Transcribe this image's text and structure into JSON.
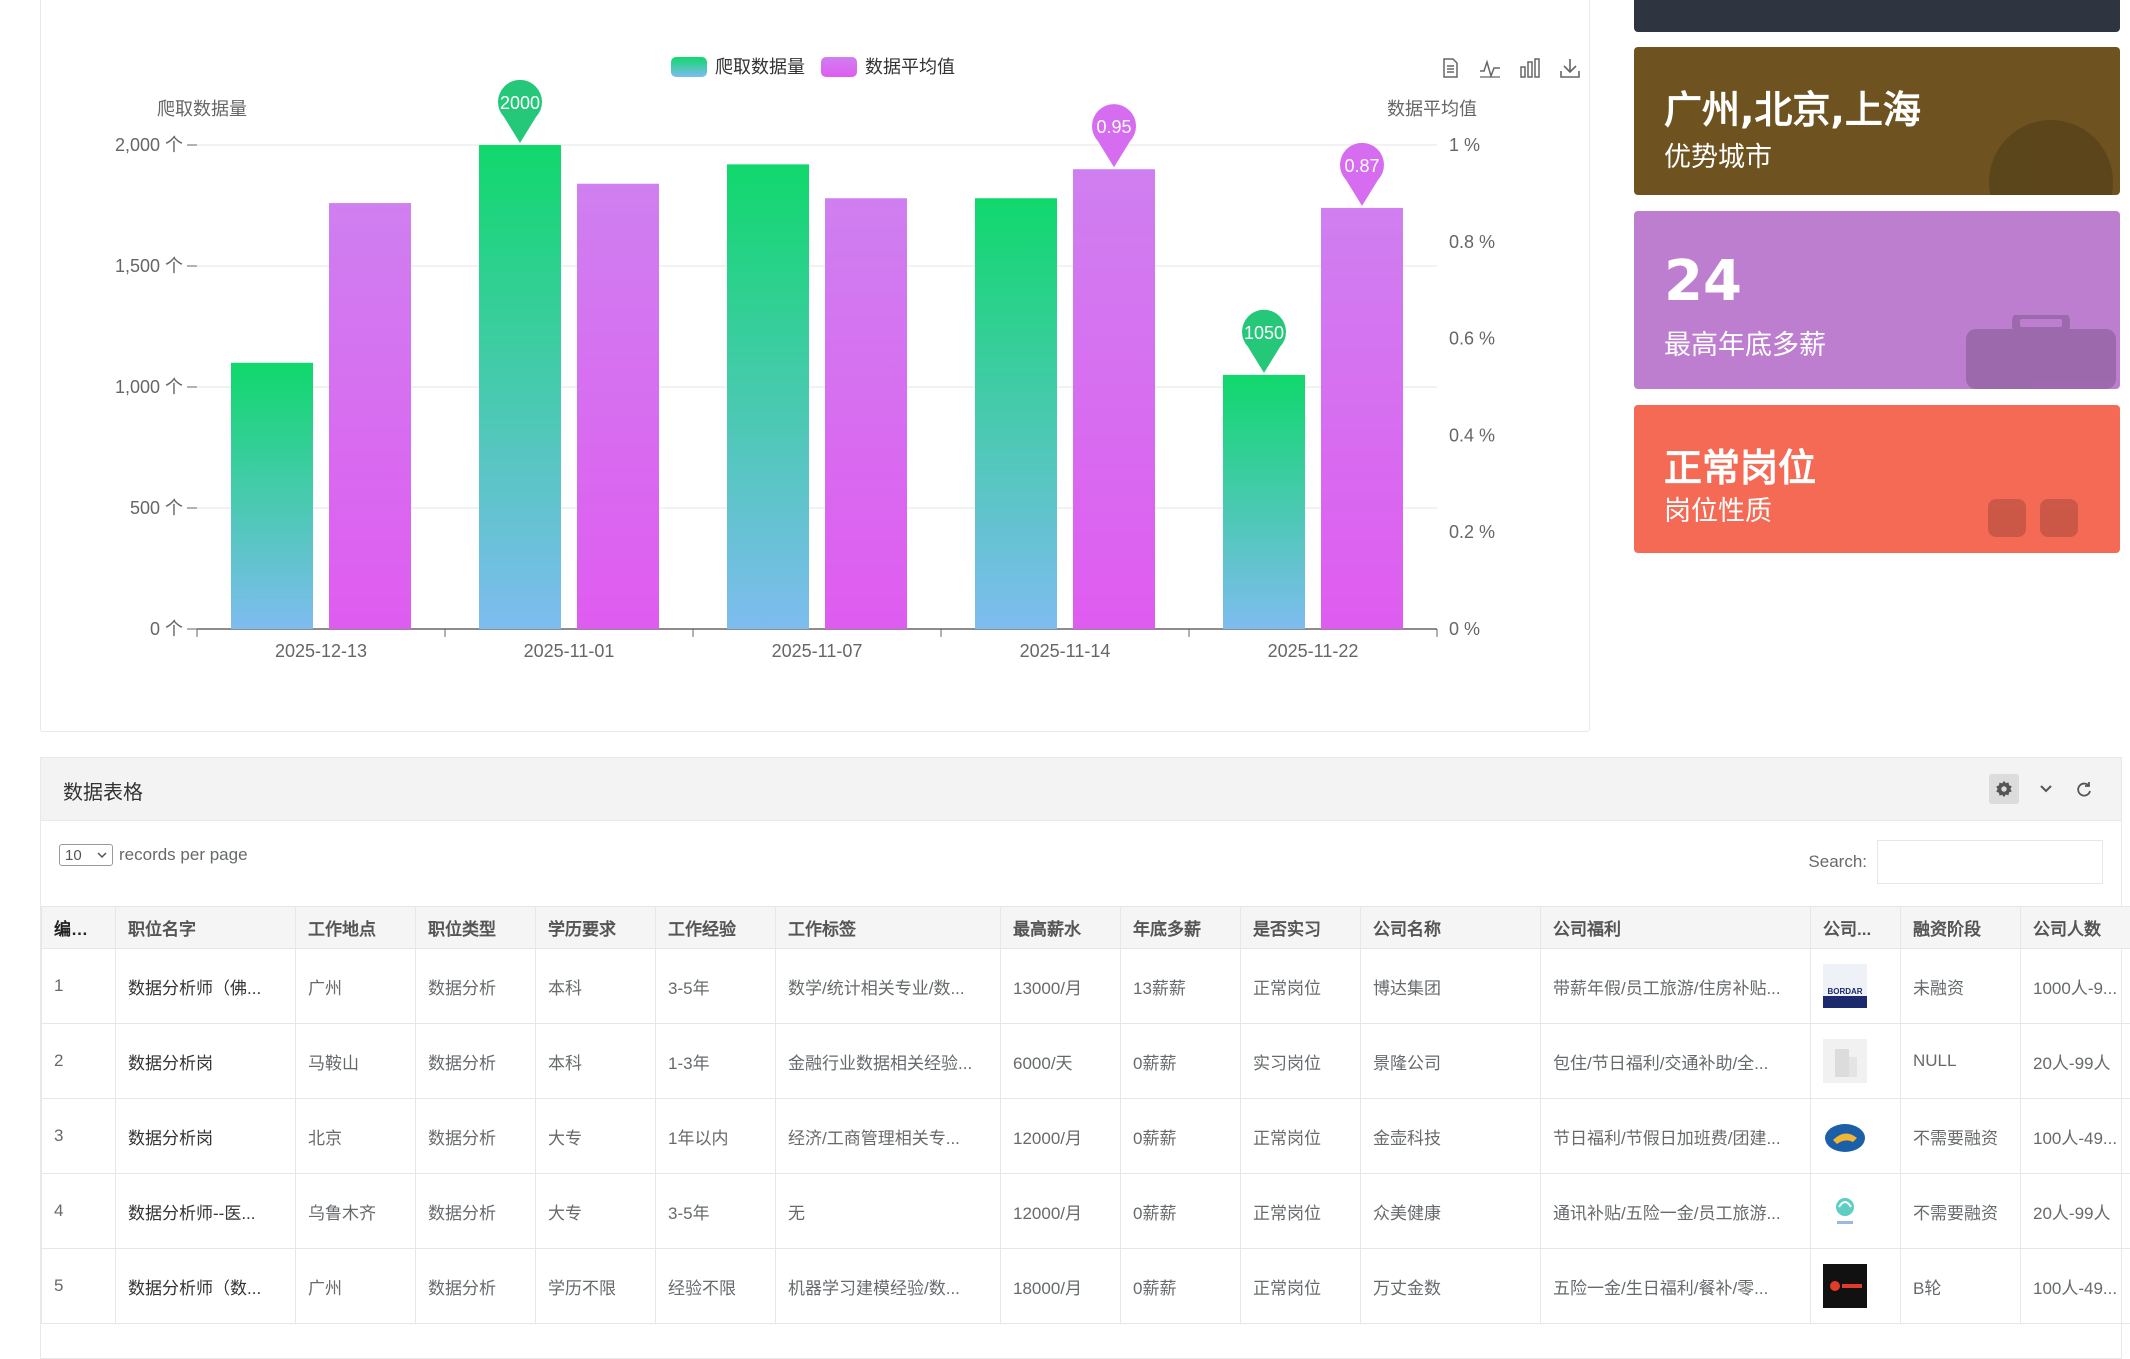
{
  "chart_data": {
    "type": "bar",
    "categories": [
      "2025-12-13",
      "2025-11-01",
      "2025-11-07",
      "2025-11-14",
      "2025-11-22"
    ],
    "series": [
      {
        "name": "爬取数据量",
        "axis": "left",
        "values": [
          1100,
          2000,
          1920,
          1780,
          1050
        ],
        "color_top": "#10d86c",
        "color_bottom": "#7ebcf0"
      },
      {
        "name": "数据平均值",
        "axis": "right",
        "values": [
          0.88,
          0.92,
          0.89,
          0.95,
          0.87
        ],
        "color_top": "#cf7ff0",
        "color_bottom": "#df5cf0"
      }
    ],
    "left_axis": {
      "name": "爬取数据量",
      "min": 0,
      "max": 2000,
      "ticks": [
        "0 个",
        "500 个",
        "1,000 个",
        "1,500 个",
        "2,000 个"
      ]
    },
    "right_axis": {
      "name": "数据平均值",
      "min": 0,
      "max": 1,
      "ticks": [
        "0 %",
        "0.2 %",
        "0.4 %",
        "0.6 %",
        "0.8 %",
        "1 %"
      ]
    },
    "markers": [
      {
        "series": 0,
        "category": 1,
        "label": "2000",
        "color": "#24c878"
      },
      {
        "series": 0,
        "category": 4,
        "label": "1050",
        "color": "#24c878"
      },
      {
        "series": 1,
        "category": 3,
        "label": "0.95",
        "color": "#d66cf0"
      },
      {
        "series": 1,
        "category": 4,
        "label": "0.87",
        "color": "#d66cf0"
      }
    ],
    "legend": {
      "position": "top-center",
      "items": [
        "爬取数据量",
        "数据平均值"
      ]
    },
    "grid": true
  },
  "toolbar": {
    "icons": [
      "data-view-icon",
      "line-chart-icon",
      "bar-chart-icon",
      "download-icon"
    ]
  },
  "cards": {
    "city": {
      "big": "广州,北京,上海",
      "sub": "优势城市",
      "color": "#6e5320"
    },
    "bonus": {
      "big": "24",
      "sub": "最高年底多薪",
      "color": "#bd7ed0"
    },
    "nature": {
      "big": "正常岗位",
      "sub": "岗位性质",
      "color": "#f46a55"
    }
  },
  "table_panel": {
    "title": "数据表格",
    "page_length": "10",
    "records_label": "records per page",
    "search_label": "Search:",
    "search_value": "",
    "columns": [
      "编号",
      "职位名字",
      "工作地点",
      "职位类型",
      "学历要求",
      "工作经验",
      "工作标签",
      "最高薪水",
      "年底多薪",
      "是否实习",
      "公司名称",
      "公司福利",
      "公司...",
      "融资阶段",
      "公司人数"
    ],
    "rows": [
      {
        "id": "1",
        "title": "数据分析师（佛...",
        "city": "广州",
        "type": "数据分析",
        "edu": "本科",
        "exp": "3-5年",
        "tags": "数学/统计相关专业/数...",
        "salary": "13000/月",
        "bonus": "13薪薪",
        "intern": "正常岗位",
        "company": "博达集团",
        "welfare": "带薪年假/员工旅游/住房补贴...",
        "logo": "bordar",
        "finance": "未融资",
        "size": "1000人-9..."
      },
      {
        "id": "2",
        "title": "数据分析岗",
        "city": "马鞍山",
        "type": "数据分析",
        "edu": "本科",
        "exp": "1-3年",
        "tags": "金融行业数据相关经验...",
        "salary": "6000/天",
        "bonus": "0薪薪",
        "intern": "实习岗位",
        "company": "景隆公司",
        "welfare": "包住/节日福利/交通补助/全...",
        "logo": "building",
        "finance": "NULL",
        "size": "20人-99人"
      },
      {
        "id": "3",
        "title": "数据分析岗",
        "city": "北京",
        "type": "数据分析",
        "edu": "大专",
        "exp": "1年以内",
        "tags": "经济/工商管理相关专...",
        "salary": "12000/月",
        "bonus": "0薪薪",
        "intern": "正常岗位",
        "company": "金壶科技",
        "welfare": "节日福利/节假日加班费/团建...",
        "logo": "lamp",
        "finance": "不需要融资",
        "size": "100人-49..."
      },
      {
        "id": "4",
        "title": "数据分析师--医...",
        "city": "乌鲁木齐",
        "type": "数据分析",
        "edu": "大专",
        "exp": "3-5年",
        "tags": "无",
        "salary": "12000/月",
        "bonus": "0薪薪",
        "intern": "正常岗位",
        "company": "众美健康",
        "welfare": "通讯补贴/五险一金/员工旅游...",
        "logo": "health",
        "finance": "不需要融资",
        "size": "20人-99人"
      },
      {
        "id": "5",
        "title": "数据分析师（数...",
        "city": "广州",
        "type": "数据分析",
        "edu": "学历不限",
        "exp": "经验不限",
        "tags": "机器学习建模经验/数...",
        "salary": "18000/月",
        "bonus": "0薪薪",
        "intern": "正常岗位",
        "company": "万丈金数",
        "welfare": "五险一金/生日福利/餐补/零...",
        "logo": "dark",
        "finance": "B轮",
        "size": "100人-49..."
      }
    ]
  }
}
